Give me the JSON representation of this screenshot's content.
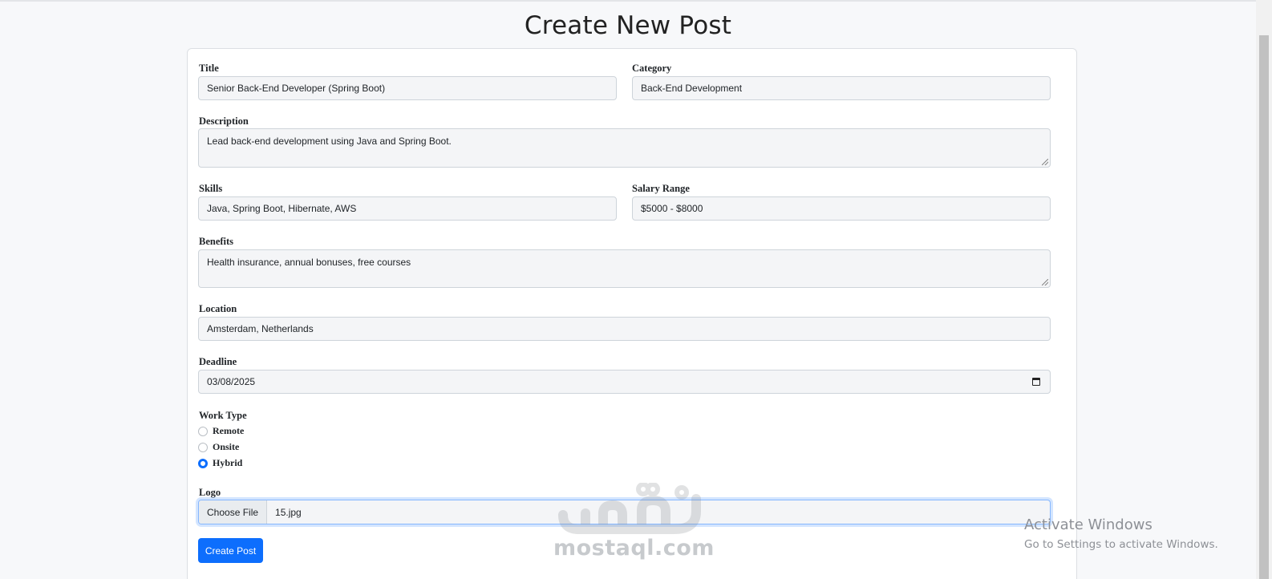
{
  "page": {
    "title": "Create New Post"
  },
  "form": {
    "title": {
      "label": "Title",
      "value": "Senior Back-End Developer (Spring Boot)"
    },
    "category": {
      "label": "Category",
      "value": "Back-End Development"
    },
    "description": {
      "label": "Description",
      "value": "Lead back-end development using Java and Spring Boot."
    },
    "skills": {
      "label": "Skills",
      "value": "Java, Spring Boot, Hibernate, AWS"
    },
    "salary": {
      "label": "Salary Range",
      "value": "$5000 - $8000"
    },
    "benefits": {
      "label": "Benefits",
      "value": "Health insurance, annual bonuses, free courses"
    },
    "location": {
      "label": "Location",
      "value": "Amsterdam, Netherlands"
    },
    "deadline": {
      "label": "Deadline",
      "value": "03/08/2025",
      "icon": "calendar-icon"
    },
    "work_type": {
      "label": "Work Type",
      "options": [
        "Remote",
        "Onsite",
        "Hybrid"
      ],
      "selected": "Hybrid"
    },
    "logo": {
      "label": "Logo",
      "button": "Choose File",
      "file_name": "15.jpg"
    },
    "submit_label": "Create Post"
  },
  "watermark": {
    "text": "mostaql.com",
    "arabic": "مستقل"
  },
  "os_notice": {
    "line1": "Activate Windows",
    "line2": "Go to Settings to activate Windows."
  },
  "colors": {
    "primary": "#0d6efd",
    "field_bg": "#f4f5f7",
    "page_bg": "#f7f8fa"
  }
}
